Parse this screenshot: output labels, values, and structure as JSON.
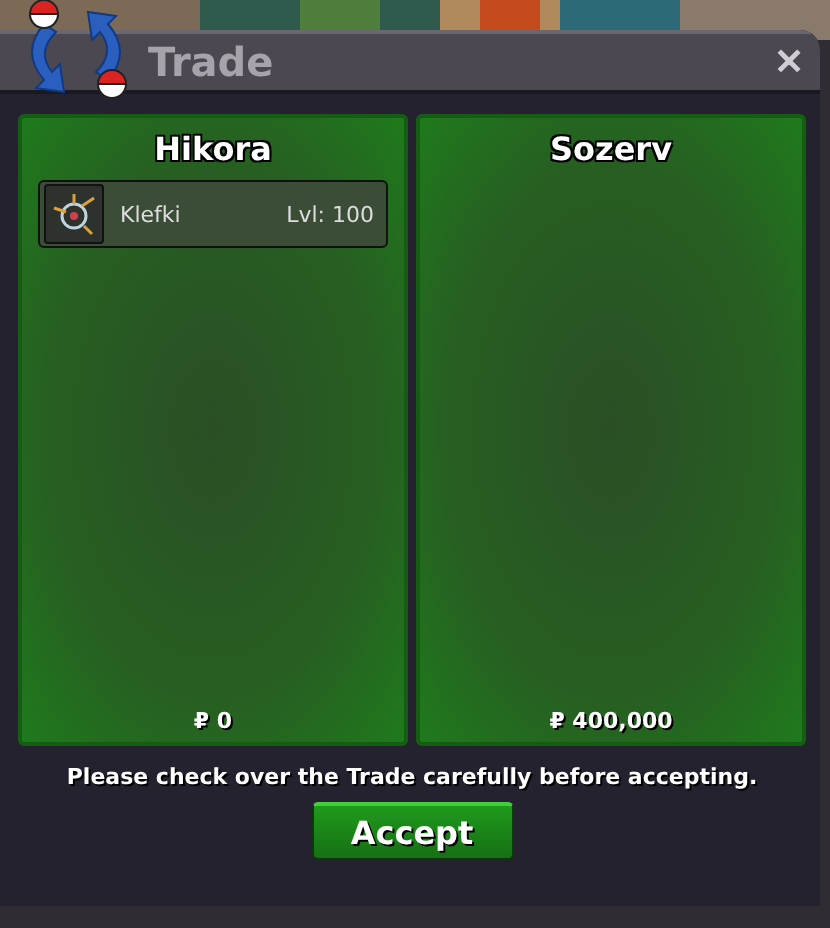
{
  "window": {
    "title": "Trade"
  },
  "traders": [
    {
      "name": "Hikora",
      "items": [
        {
          "name": "Klefki",
          "level": "Lvl: 100"
        }
      ],
      "money": "₽ 0"
    },
    {
      "name": "Sozerv",
      "money": "₽ 400,000"
    }
  ],
  "notice": "Please check over the Trade carefully before accepting.",
  "buttons": [
    "Accept"
  ],
  "close": "✕"
}
